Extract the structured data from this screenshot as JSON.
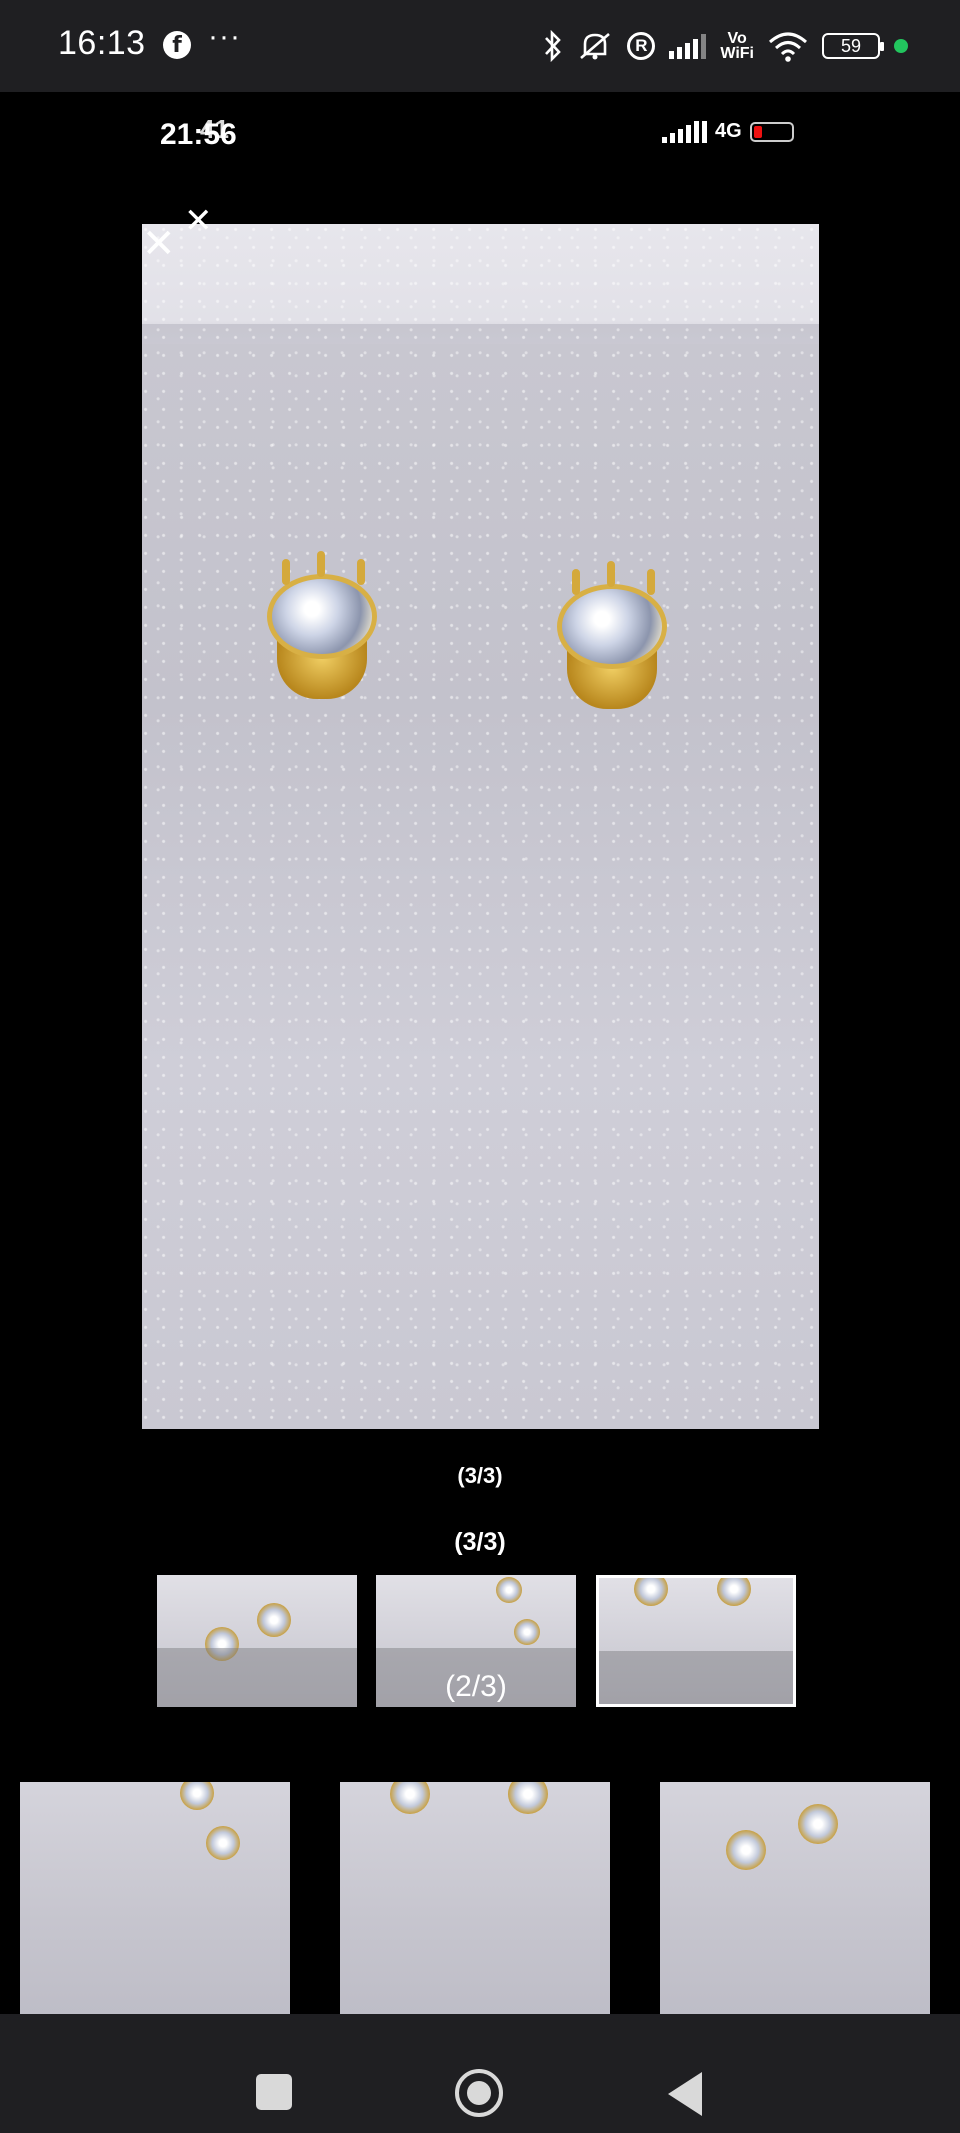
{
  "status_bar": {
    "time": "16:13",
    "app_icon": "facebook-icon",
    "more": "···",
    "icons": [
      "bluetooth-icon",
      "mute-icon",
      "registered-icon",
      "signal-icon",
      "vowifi-icon",
      "wifi-icon",
      "battery-icon"
    ],
    "r_label": "R",
    "vowifi_label": "Vo\nWiFi",
    "battery_level": "59",
    "dot_color": "#22c55e"
  },
  "inner_screenshot": {
    "time": "21:56",
    "time_ghost": "41",
    "network": "4G"
  },
  "viewer": {
    "close_icons": [
      "close-icon",
      "close-icon"
    ],
    "counter_small": "(3/3)",
    "counter_large": "(3/3)",
    "thumbnail_overlay": "(2/3)"
  },
  "colors": {
    "background": "#000000",
    "bar": "#1f1f22",
    "selected_border": "#ffffff"
  },
  "nav_bar": {
    "buttons": [
      "recents-icon",
      "home-icon",
      "back-icon"
    ]
  }
}
